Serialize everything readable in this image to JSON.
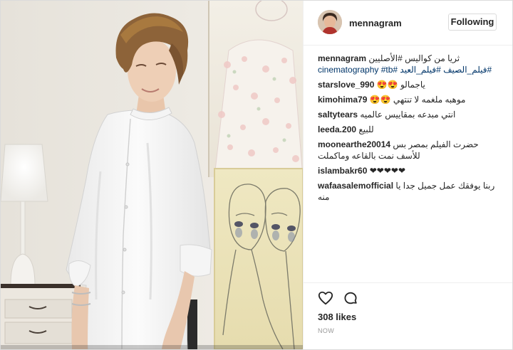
{
  "post": {
    "username": "mennagram",
    "follow_label": "Following",
    "caption": {
      "username": "mennagram",
      "text": "ثريا من كواليس #الأصليين",
      "hashtags_line2": "#فيلم_الصيف #فيلم_العيد #cinematography #tb"
    },
    "comments": [
      {
        "user": "starslove_990",
        "text": "ياجمالو 😍😍"
      },
      {
        "user": "kimohima79",
        "text": "موهبه ملغمه لا تنتهي 😍😍"
      },
      {
        "user": "saltytears",
        "text": "انتي مبدعه بمقاييس عالميه"
      },
      {
        "user": "leeda.200",
        "text": "للبيع"
      },
      {
        "user": "moonearthe20014",
        "text": "حضرت الفيلم بمصر بس للأسف نمت بالقاعه وماكملت"
      },
      {
        "user": "islambakr60",
        "text": "❤❤❤❤❤"
      },
      {
        "user": "wafaasalemofficial",
        "text": "ربنا يوفقك عمل جميل جدا يا منه"
      }
    ],
    "likes": "308 likes",
    "time": "NOW"
  },
  "icons": {
    "like": "heart-icon",
    "comment": "comment-bubble-icon",
    "avatar": "avatar"
  }
}
